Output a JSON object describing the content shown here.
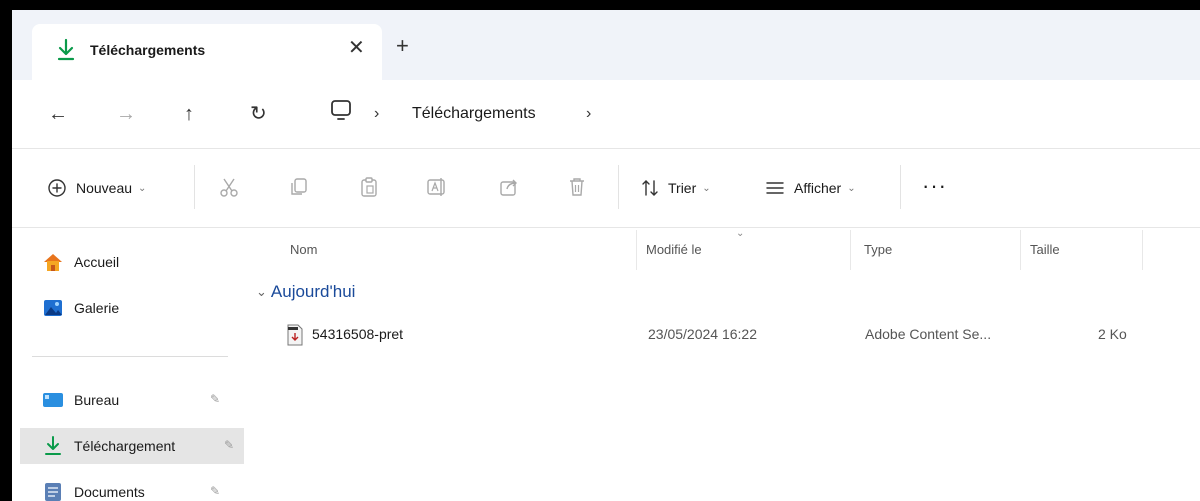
{
  "tab": {
    "title": "Téléchargements",
    "close": "✕",
    "new_tab": "+"
  },
  "nav": {
    "back": "←",
    "forward": "→",
    "up": "↑",
    "refresh": "↻"
  },
  "address": {
    "separator": "›",
    "path": "Téléchargements",
    "trailing_separator": "›"
  },
  "toolbar": {
    "new_label": "Nouveau",
    "sort_label": "Trier",
    "view_label": "Afficher",
    "more": "···",
    "chevron": "⌄"
  },
  "sidebar": {
    "items": [
      {
        "label": "Accueil"
      },
      {
        "label": "Galerie"
      },
      {
        "label": "Bureau"
      },
      {
        "label": "Téléchargement"
      },
      {
        "label": "Documents"
      }
    ],
    "pin": "✎"
  },
  "columns": {
    "name": "Nom",
    "modified": "Modifié le",
    "type": "Type",
    "size": "Taille"
  },
  "group": {
    "label": "Aujourd'hui",
    "chevron": "⌄"
  },
  "files": [
    {
      "name": "54316508-pret",
      "modified": "23/05/2024 16:22",
      "type": "Adobe Content Se...",
      "size": "2 Ko"
    }
  ],
  "colors": {
    "accent": "#0a7d3c",
    "link_blue": "#1a4a9a",
    "selected_bg": "#e5e5e5"
  }
}
